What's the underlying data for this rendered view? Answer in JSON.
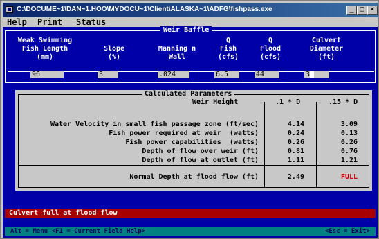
{
  "window": {
    "title": "C:\\DOCUME~1\\DAN~1.HOO\\MYDOCU~1\\Client\\ALASKA~1\\ADFG\\fishpass.exe",
    "controls": [
      "_",
      "□",
      "×"
    ]
  },
  "menu": [
    "Help",
    "Print",
    "Status"
  ],
  "inputs": {
    "frame_title": "Weir Baffle",
    "headers": [
      "Weak Swimming\nFish Length\n(mm)",
      "Slope\n(%)",
      "Manning n\nWall",
      "Q\nFish\n(cfs)",
      "Q\nFlood\n(cfs)",
      "Culvert\nDiameter\n(ft)"
    ],
    "values": [
      "96",
      "3",
      ".024",
      "6.5",
      "44",
      "3"
    ]
  },
  "calc": {
    "title": "Calculated Parameters",
    "weir_height_label": "Weir Height",
    "col1_header": ".1 * D",
    "col2_header": ".15 * D",
    "rows": [
      {
        "label": "Water Velocity in small fish passage zone (ft/sec)",
        "v1": "4.14",
        "v2": "3.09"
      },
      {
        "label": "Fish power required at weir  (watts)",
        "v1": "0.24",
        "v2": "0.13"
      },
      {
        "label": "Fish power capabilities  (watts)",
        "v1": "0.26",
        "v2": "0.26"
      },
      {
        "label": "Depth of flow over weir (ft)",
        "v1": "0.81",
        "v2": "0.76"
      },
      {
        "label": "Depth of flow at outlet (ft)",
        "v1": "1.11",
        "v2": "1.21"
      }
    ],
    "normal_depth": {
      "label": "Normal Depth at flood flow (ft)",
      "v1": "2.49",
      "v2": "FULL"
    }
  },
  "status_message": "Culvert full at flood flow",
  "help_bar": {
    "left": "Alt = Menu <F1 = Current Field Help>",
    "right": "<Esc = Exit>"
  },
  "colors": {
    "screen_blue": "#0000a8",
    "status_red": "#a80000",
    "help_teal": "#008080",
    "full_red": "#c80000"
  }
}
